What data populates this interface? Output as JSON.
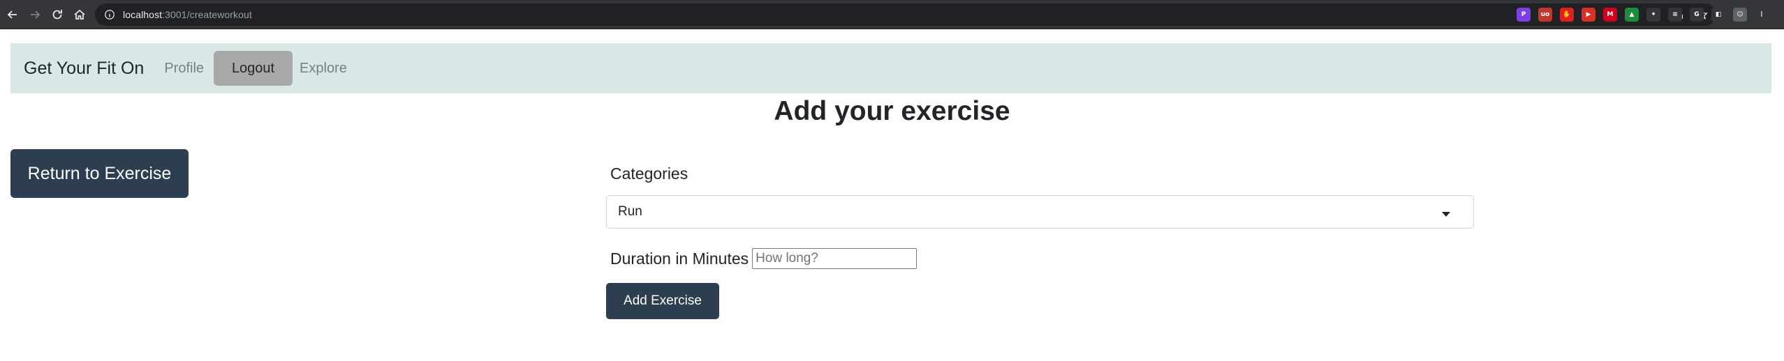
{
  "browser": {
    "url_host": "localhost",
    "url_path": ":3001/createworkout",
    "extensions": [
      {
        "icon": "p-extension-icon",
        "label": "P",
        "color": "#7b3fe4"
      },
      {
        "icon": "ublock-icon",
        "label": "uo",
        "color": "#c0392b"
      },
      {
        "icon": "adblock-hand-icon",
        "label": "✋",
        "color": "#e02020"
      },
      {
        "icon": "video-extension-icon",
        "label": "▶",
        "color": "#d93025"
      },
      {
        "icon": "m-extension-icon",
        "label": "M",
        "color": "#d0021b"
      },
      {
        "icon": "drive-icon",
        "label": "▲",
        "color": "#1e8e3e"
      },
      {
        "icon": "puzzle-icon",
        "label": "✦",
        "color": "#35363a"
      },
      {
        "icon": "reading-list-icon",
        "label": "≡",
        "color": "#35363a"
      },
      {
        "icon": "google-icon",
        "label": "G",
        "color": "#35363a"
      },
      {
        "icon": "side-panel-icon",
        "label": "◧",
        "color": "#35363a"
      },
      {
        "icon": "profile-avatar-icon",
        "label": "☺",
        "color": "#5f6368"
      },
      {
        "icon": "kebab-menu-icon",
        "label": "⋮",
        "color": "#35363a"
      }
    ]
  },
  "navbar": {
    "brand": "Get Your Fit On",
    "profile_label": "Profile",
    "logout_label": "Logout",
    "explore_label": "Explore"
  },
  "main": {
    "title": "Add your exercise",
    "return_button_label": "Return to Exercise"
  },
  "form": {
    "categories_label": "Categories",
    "category_selected": "Run",
    "duration_label": "Duration in Minutes",
    "duration_placeholder": "How long?",
    "duration_value": "",
    "submit_label": "Add Exercise"
  },
  "colors": {
    "navbar_bg": "#d8e8e6",
    "primary_button": "#2c3e50",
    "logout_button": "#a9a9a9",
    "chrome_bg": "#35363a"
  }
}
